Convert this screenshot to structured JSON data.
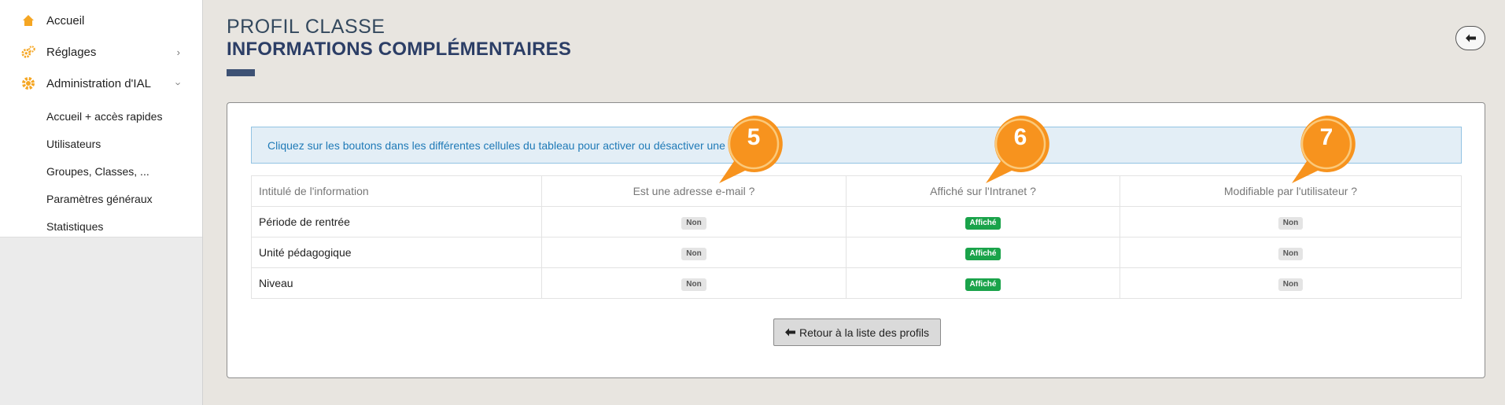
{
  "sidebar": {
    "items": [
      {
        "label": "Accueil",
        "icon": "home-icon"
      },
      {
        "label": "Réglages",
        "icon": "gears-icon"
      },
      {
        "label": "Administration d'IAL",
        "icon": "gear-icon"
      }
    ],
    "subitems": [
      {
        "label": "Accueil + accès rapides"
      },
      {
        "label": "Utilisateurs"
      },
      {
        "label": "Groupes, Classes, ..."
      },
      {
        "label": "Paramètres généraux"
      },
      {
        "label": "Statistiques"
      }
    ]
  },
  "header": {
    "subtitle": "PROFIL CLASSE",
    "title": "INFORMATIONS COMPLÉMENTAIRES",
    "back_icon": "arrow-left-icon"
  },
  "panel": {
    "info_text": "Cliquez sur les boutons dans les différentes cellules du tableau pour activer ou désactiver une",
    "table": {
      "columns": [
        "Intitulé de l'information",
        "Est une adresse e-mail ?",
        "Affiché sur l'Intranet ?",
        "Modifiable par l'utilisateur ?"
      ],
      "rows": [
        {
          "label": "Période de rentrée",
          "email": "Non",
          "intranet": "Affiché",
          "modifiable": "Non"
        },
        {
          "label": "Unité pédagogique",
          "email": "Non",
          "intranet": "Affiché",
          "modifiable": "Non"
        },
        {
          "label": "Niveau",
          "email": "Non",
          "intranet": "Affiché",
          "modifiable": "Non"
        }
      ]
    },
    "back_button": "Retour à la liste des profils"
  },
  "callouts": [
    {
      "number": "5"
    },
    {
      "number": "6"
    },
    {
      "number": "7"
    }
  ],
  "colors": {
    "accent_orange": "#f7931e",
    "badge_on": "#1aa34a",
    "title_navy": "#2c3e66"
  }
}
